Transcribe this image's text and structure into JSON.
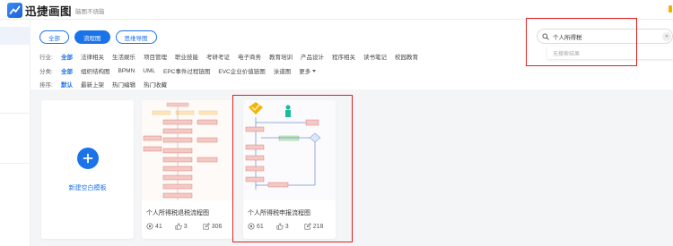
{
  "header": {
    "app_name": "迅捷画图",
    "slogan": "脑图不烧脑"
  },
  "tabs": [
    {
      "label": "全部",
      "active": false
    },
    {
      "label": "流程图",
      "active": true
    },
    {
      "label": "思维导图",
      "active": false
    }
  ],
  "filters": {
    "industry": {
      "label": "行业:",
      "items": [
        "全部",
        "法律相关",
        "生活娱乐",
        "项目管理",
        "职业技能",
        "考研考证",
        "电子商务",
        "教育培训",
        "产品设计",
        "程序相关",
        "读书笔记",
        "校园教育"
      ]
    },
    "category": {
      "label": "分类:",
      "items": [
        "全部",
        "组织结构图",
        "BPMN",
        "UML",
        "EPC事件过程链图",
        "EVC企业价值链图",
        "泳道图"
      ],
      "more": "更多"
    },
    "sort": {
      "label": "排序:",
      "items": [
        "默认",
        "最新上架",
        "热门编辑",
        "热门收藏"
      ]
    }
  },
  "search": {
    "value": "个人所得税",
    "no_result": "无搜索结果"
  },
  "new_template": {
    "label": "新建空白模板"
  },
  "templates": [
    {
      "title": "个人所得税退税流程图",
      "views": "41",
      "likes": "3",
      "edits": "306"
    },
    {
      "title": "个人所得税申报流程图",
      "views": "61",
      "likes": "3",
      "edits": "218"
    }
  ],
  "colors": {
    "accent": "#1a73e8",
    "highlight_border": "#e02020"
  }
}
